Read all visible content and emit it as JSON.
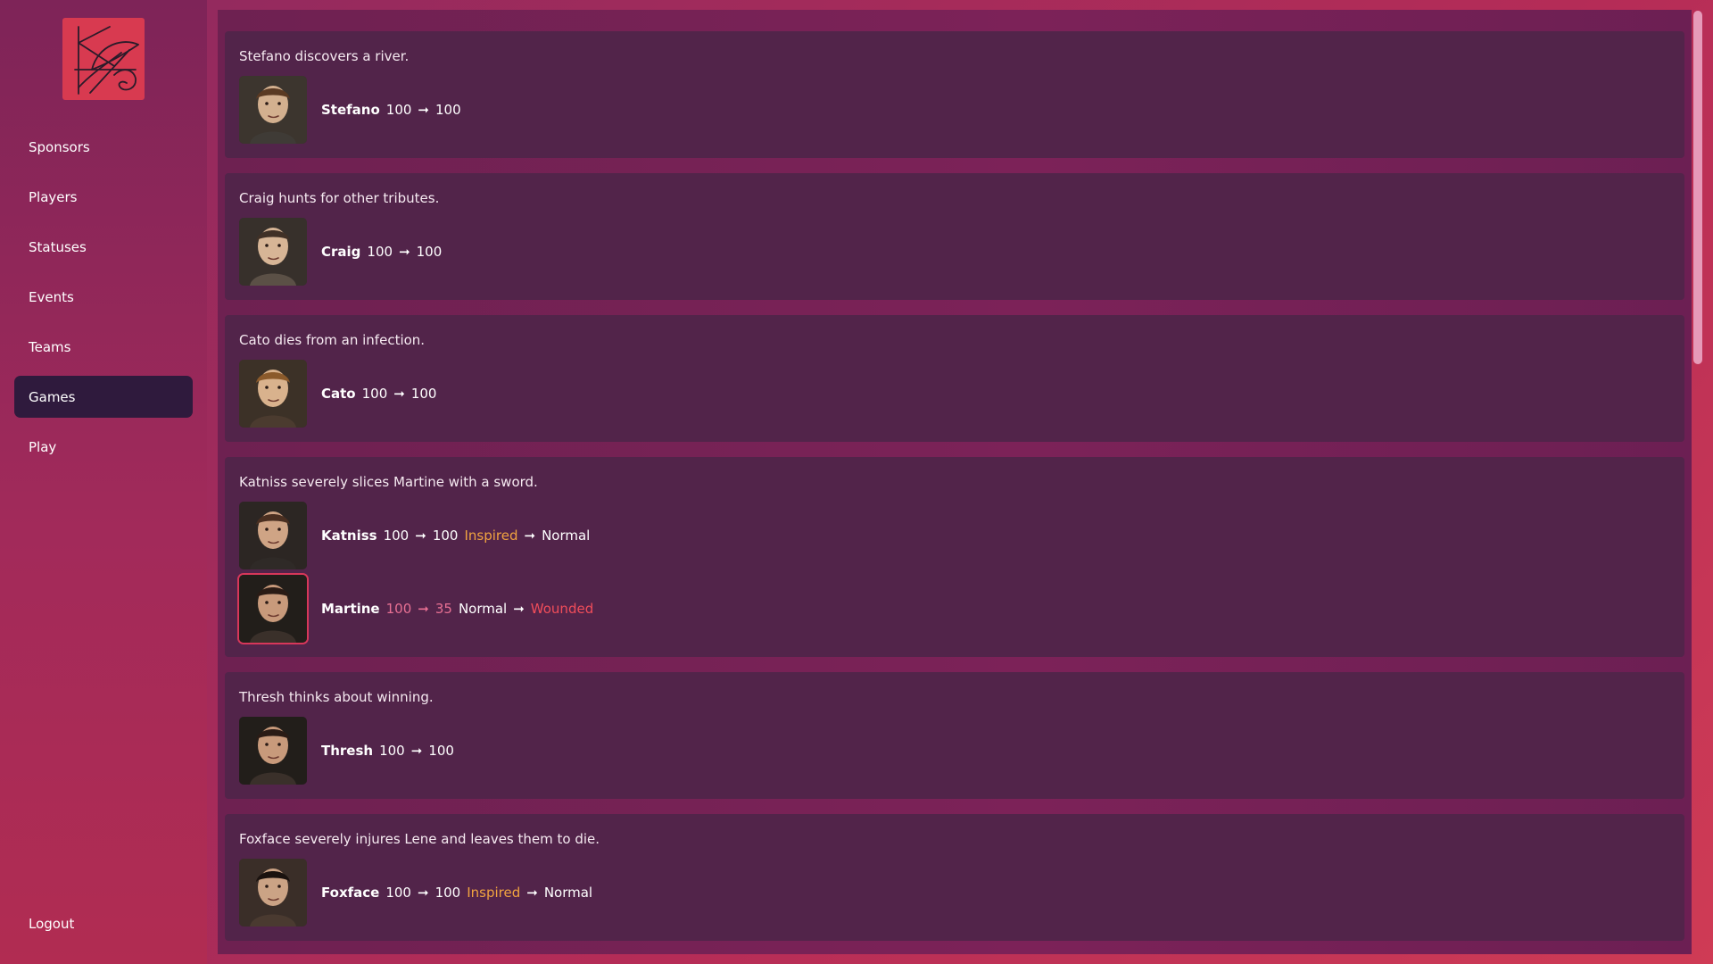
{
  "nav": {
    "items": [
      "Sponsors",
      "Players",
      "Statuses",
      "Events",
      "Teams",
      "Games",
      "Play"
    ],
    "active": "Games",
    "logout": "Logout"
  },
  "events": [
    {
      "text": "Stefano discovers a river.",
      "participants": [
        {
          "name": "Stefano",
          "hp_before": "100",
          "hp_after": "100",
          "status_before": "",
          "status_after": "",
          "hit": false
        }
      ]
    },
    {
      "text": "Craig hunts for other tributes.",
      "participants": [
        {
          "name": "Craig",
          "hp_before": "100",
          "hp_after": "100",
          "status_before": "",
          "status_after": "",
          "hit": false
        }
      ]
    },
    {
      "text": "Cato dies from an infection.",
      "participants": [
        {
          "name": "Cato",
          "hp_before": "100",
          "hp_after": "100",
          "status_before": "",
          "status_after": "",
          "hit": false
        }
      ]
    },
    {
      "text": "Katniss severely slices Martine with a sword.",
      "participants": [
        {
          "name": "Katniss",
          "hp_before": "100",
          "hp_after": "100",
          "status_before": "Inspired",
          "status_after": "Normal",
          "hit": false
        },
        {
          "name": "Martine",
          "hp_before": "100",
          "hp_after": "35",
          "status_before": "Normal",
          "status_after": "Wounded",
          "hit": true
        }
      ]
    },
    {
      "text": "Thresh thinks about winning.",
      "participants": [
        {
          "name": "Thresh",
          "hp_before": "100",
          "hp_after": "100",
          "status_before": "",
          "status_after": "",
          "hit": false
        }
      ]
    },
    {
      "text": "Foxface severely injures Lene and leaves them to die.",
      "participants": [
        {
          "name": "Foxface",
          "hp_before": "100",
          "hp_after": "100",
          "status_before": "Inspired",
          "status_after": "Normal",
          "hit": false
        }
      ]
    }
  ],
  "colors": {
    "accent_orange": "#f0a340",
    "accent_red": "#f04d5a",
    "card": "#52244a",
    "nav_active": "#2f1a3d"
  }
}
